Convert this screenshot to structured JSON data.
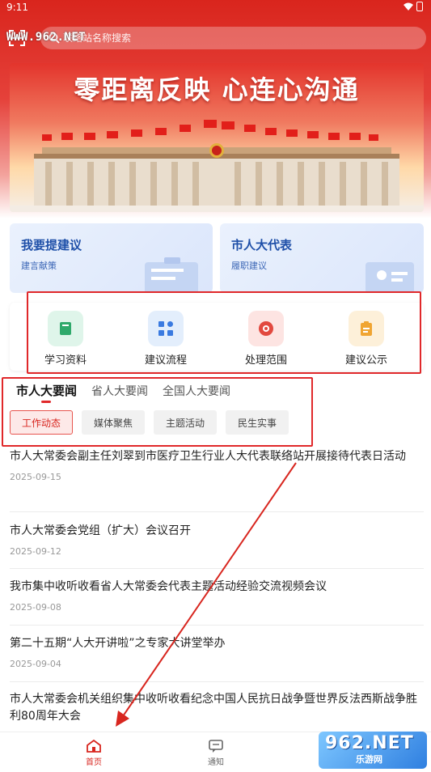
{
  "status_bar": {
    "time": "9:11"
  },
  "search": {
    "placeholder": "联络站名称搜索"
  },
  "watermark_top": "WWW.962.NET",
  "banner": {
    "slogan": "零距离反映  心连心沟通"
  },
  "cards": [
    {
      "title": "我要提建议",
      "subtitle": "建言献策"
    },
    {
      "title": "市人大代表",
      "subtitle": "履职建议"
    }
  ],
  "quick_icons": [
    {
      "label": "学习资料",
      "icon": "book-icon",
      "bg": "#dff5ea",
      "color": "#2fa96b"
    },
    {
      "label": "建议流程",
      "icon": "flow-icon",
      "bg": "#e3eefc",
      "color": "#3a7ae0"
    },
    {
      "label": "处理范围",
      "icon": "target-icon",
      "bg": "#fde4e2",
      "color": "#e2493f"
    },
    {
      "label": "建议公示",
      "icon": "clipboard-icon",
      "bg": "#fdf0d9",
      "color": "#f0a532"
    }
  ],
  "tabs": [
    {
      "label": "市人大要闻",
      "active": true
    },
    {
      "label": "省人大要闻",
      "active": false
    },
    {
      "label": "全国人大要闻",
      "active": false
    }
  ],
  "chips": [
    {
      "label": "工作动态",
      "active": true
    },
    {
      "label": "媒体聚焦",
      "active": false
    },
    {
      "label": "主题活动",
      "active": false
    },
    {
      "label": "民生实事",
      "active": false
    }
  ],
  "news": [
    {
      "title": "市人大常委会副主任刘翠到市医疗卫生行业人大代表联络站开展接待代表日活动",
      "date": "2025-09-15"
    },
    {
      "title": "市人大常委会党组（扩大）会议召开",
      "date": "2025-09-12"
    },
    {
      "title": "我市集中收听收看省人大常委会代表主题活动经验交流视频会议",
      "date": "2025-09-08"
    },
    {
      "title": "第二十五期“人大开讲啦”之专家大讲堂举办",
      "date": "2025-09-04"
    },
    {
      "title": "市人大常委会机关组织集中收听收看纪念中国人民抗日战争暨世界反法西斯战争胜利80周年大会",
      "date": ""
    }
  ],
  "bottom_nav": [
    {
      "label": "首页",
      "active": true
    },
    {
      "label": "通知",
      "active": false
    }
  ],
  "watermark_br": {
    "big": "962.NET",
    "small": "乐游网"
  },
  "colors": {
    "primary_red": "#d9251d",
    "annotation_red": "#e0282a"
  }
}
